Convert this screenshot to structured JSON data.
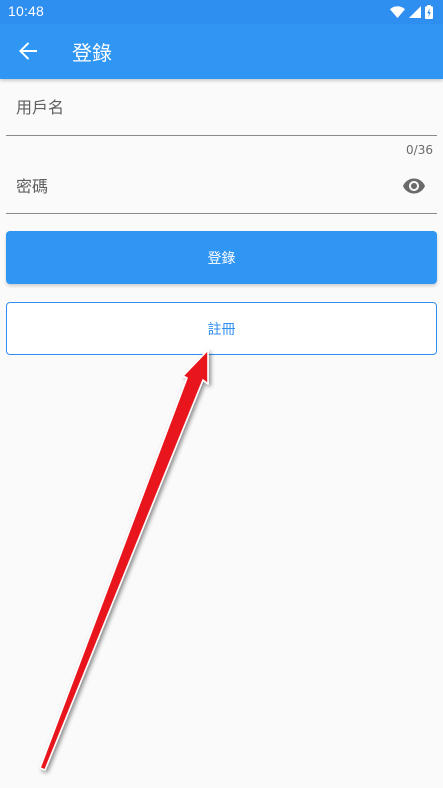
{
  "status_bar": {
    "time": "10:48",
    "icons": [
      "wifi-icon",
      "cellular-signal-icon",
      "battery-charging-icon"
    ]
  },
  "app_bar": {
    "back_icon": "arrow-back-icon",
    "title": "登錄"
  },
  "form": {
    "username_placeholder": "用戶名",
    "username_value": "",
    "username_counter": "0/36",
    "password_placeholder": "密碼",
    "password_value": "",
    "visibility_icon": "eye-icon"
  },
  "buttons": {
    "login_label": "登錄",
    "register_label": "註冊"
  },
  "annotation": {
    "type": "red-arrow",
    "points_to": "register-button"
  },
  "colors": {
    "primary": "#2f96f3",
    "status_bar": "#2f8ff0",
    "background": "#fafafa",
    "arrow": "#e8141c"
  }
}
